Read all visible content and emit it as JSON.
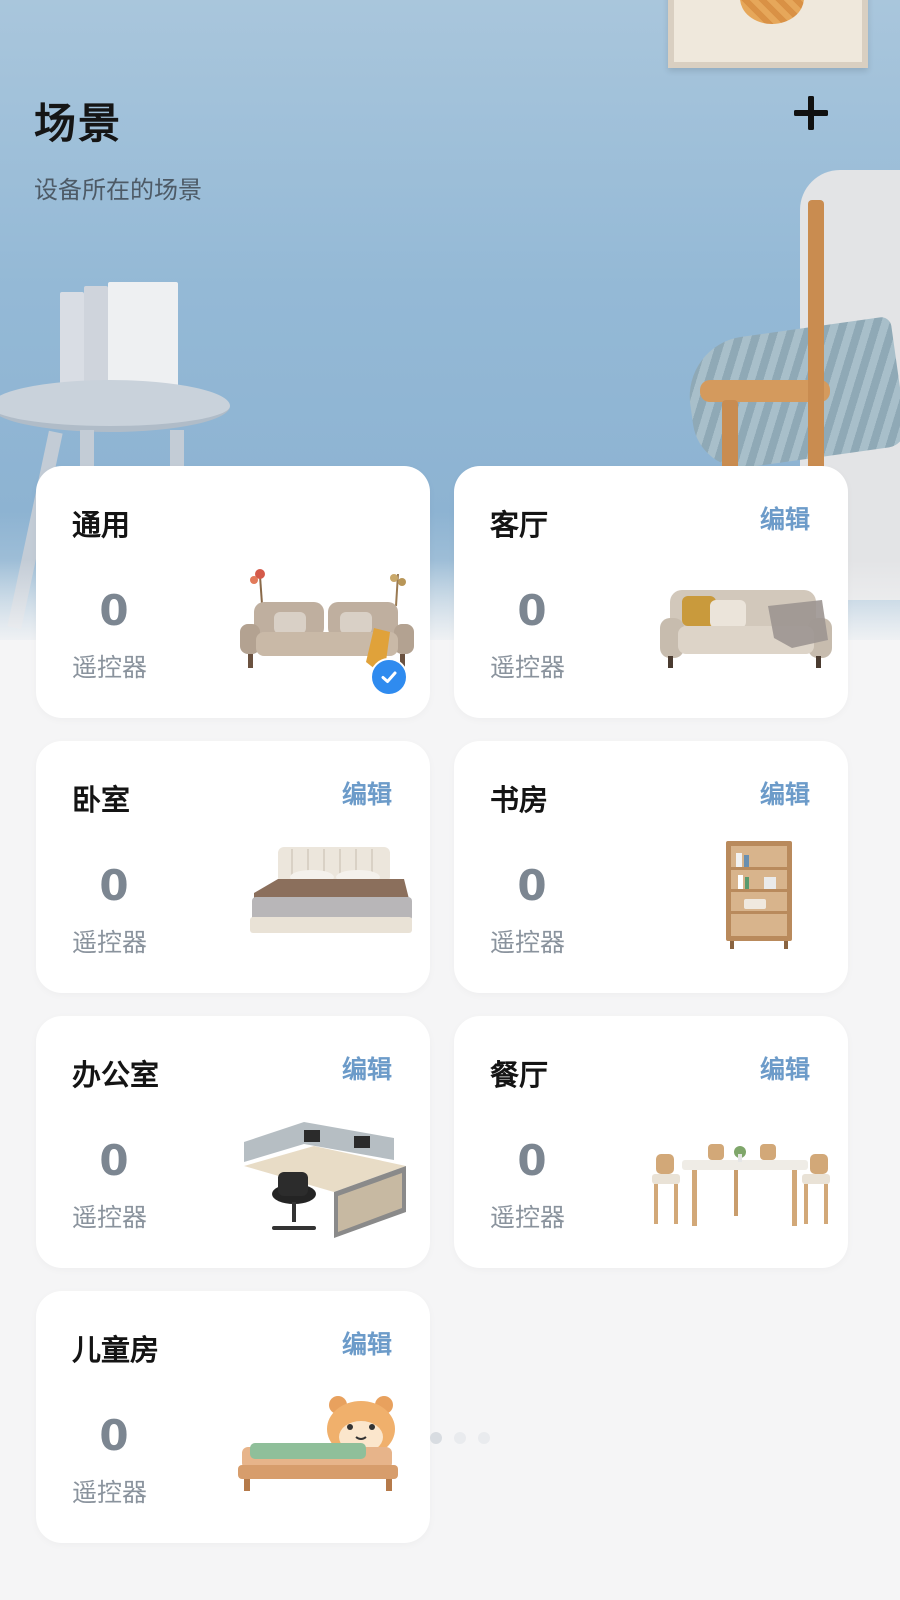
{
  "header": {
    "title": "场景",
    "subtitle": "设备所在的场景",
    "add_icon": "plus-icon"
  },
  "scenes": [
    {
      "name": "通用",
      "count": "0",
      "unit": "遥控器",
      "edit_label": "",
      "selected": true,
      "illustration": "sofa-icon"
    },
    {
      "name": "客厅",
      "count": "0",
      "unit": "遥控器",
      "edit_label": "编辑",
      "selected": false,
      "illustration": "sofa-icon"
    },
    {
      "name": "卧室",
      "count": "0",
      "unit": "遥控器",
      "edit_label": "编辑",
      "selected": false,
      "illustration": "bed-icon"
    },
    {
      "name": "书房",
      "count": "0",
      "unit": "遥控器",
      "edit_label": "编辑",
      "selected": false,
      "illustration": "bookshelf-icon"
    },
    {
      "name": "办公室",
      "count": "0",
      "unit": "遥控器",
      "edit_label": "编辑",
      "selected": false,
      "illustration": "office-desk-icon"
    },
    {
      "name": "餐厅",
      "count": "0",
      "unit": "遥控器",
      "edit_label": "编辑",
      "selected": false,
      "illustration": "dining-table-icon"
    },
    {
      "name": "儿童房",
      "count": "0",
      "unit": "遥控器",
      "edit_label": "编辑",
      "selected": false,
      "illustration": "kids-bed-icon"
    }
  ],
  "colors": {
    "accent": "#6c9bc9",
    "check": "#2f8bef",
    "background": "#f5f5f6",
    "hero": "#94b9d6"
  }
}
